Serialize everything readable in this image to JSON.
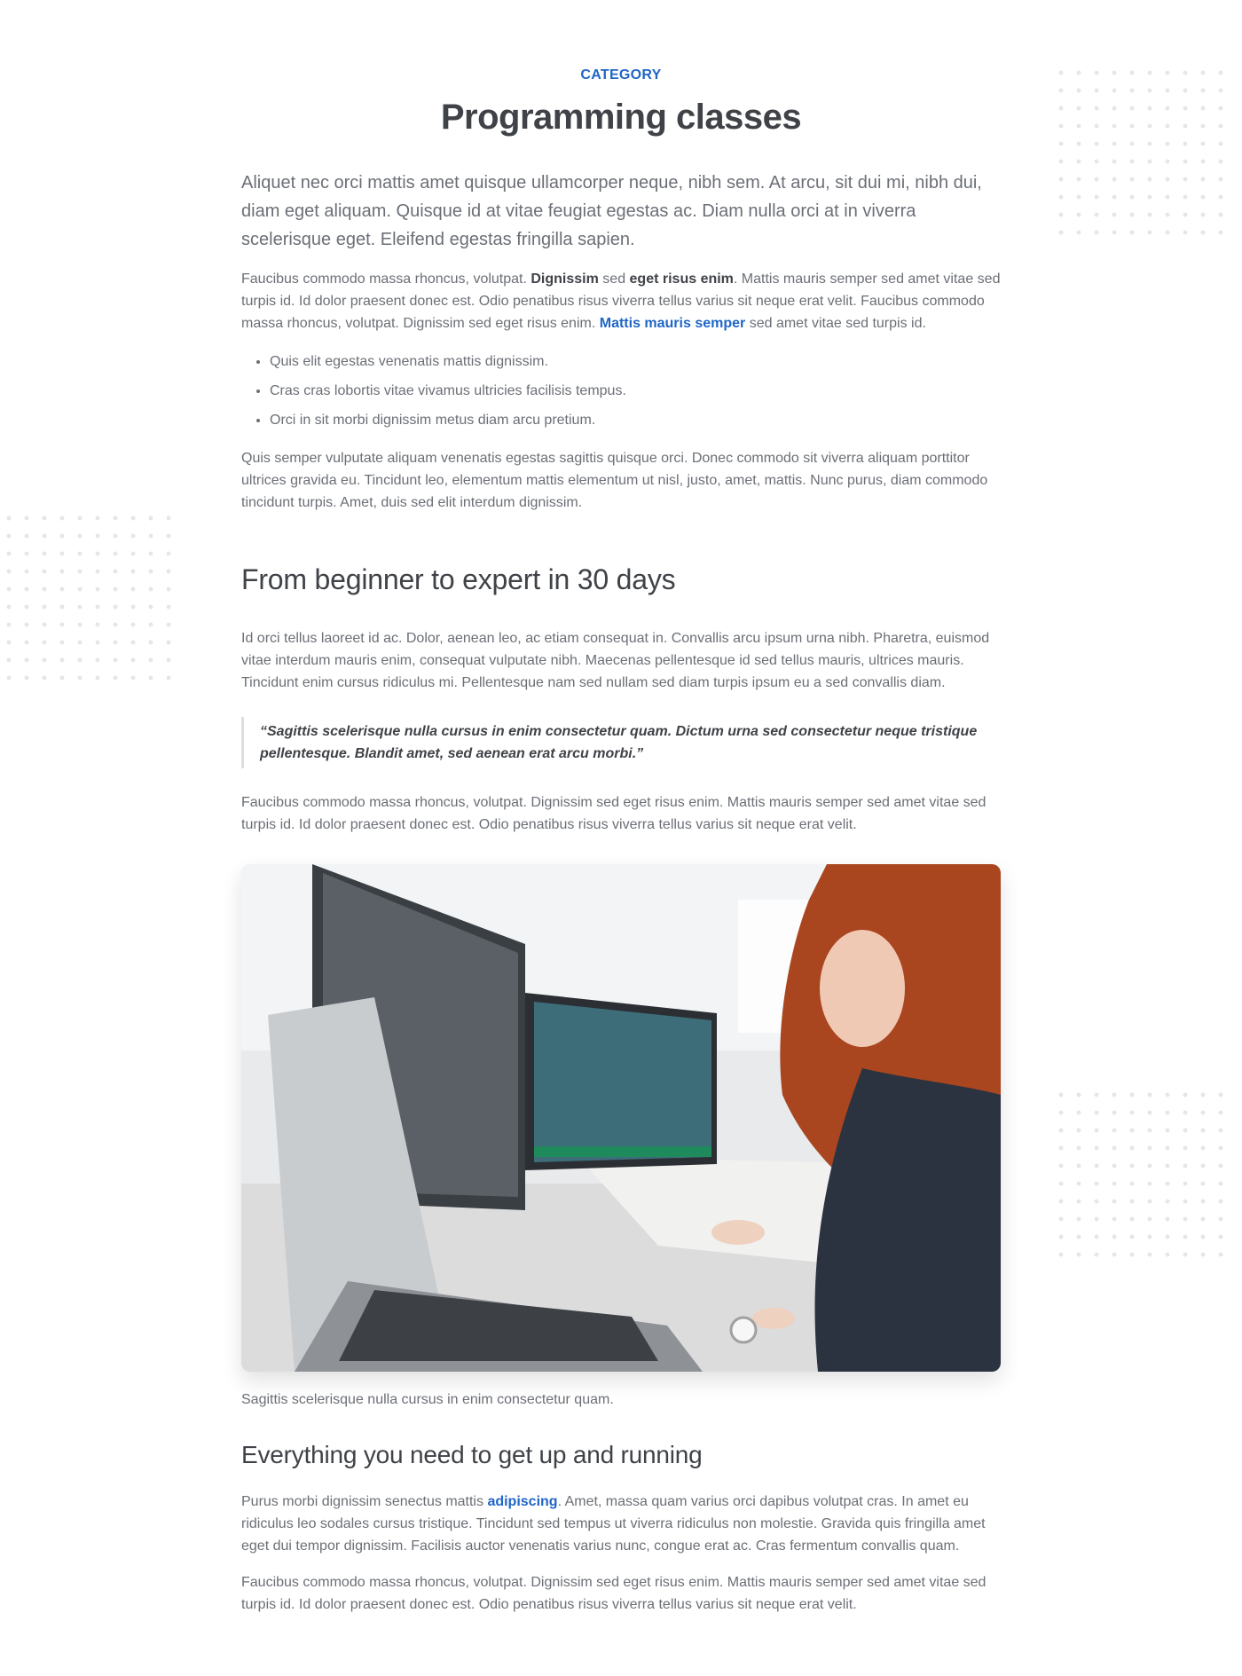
{
  "category": "CATEGORY",
  "title": "Programming classes",
  "lede": "Aliquet nec orci mattis amet quisque ullamcorper neque, nibh sem. At arcu, sit dui mi, nibh dui, diam eget aliquam. Quisque id at vitae feugiat egestas ac. Diam nulla orci at in viverra scelerisque eget. Eleifend egestas fringilla sapien.",
  "para1": {
    "t1": "Faucibus commodo massa rhoncus, volutpat. ",
    "b1": "Dignissim",
    "t2": " sed ",
    "b2": "eget risus enim",
    "t3": ". Mattis mauris semper sed amet vitae sed turpis id. Id dolor praesent donec est. Odio penatibus risus viverra tellus varius sit neque erat velit. Faucibus commodo massa rhoncus, volutpat. Dignissim sed eget risus enim. ",
    "link": "Mattis mauris semper",
    "t4": " sed amet vitae sed turpis id."
  },
  "bullets": [
    "Quis elit egestas venenatis mattis dignissim.",
    "Cras cras lobortis vitae vivamus ultricies facilisis tempus.",
    "Orci in sit morbi dignissim metus diam arcu pretium."
  ],
  "para2": "Quis semper vulputate aliquam venenatis egestas sagittis quisque orci. Donec commodo sit viverra aliquam porttitor ultrices gravida eu. Tincidunt leo, elementum mattis elementum ut nisl, justo, amet, mattis. Nunc purus, diam commodo tincidunt turpis. Amet, duis sed elit interdum dignissim.",
  "heading2": "From beginner to expert in 30 days",
  "para3": "Id orci tellus laoreet id ac. Dolor, aenean leo, ac etiam consequat in. Convallis arcu ipsum urna nibh. Pharetra, euismod vitae interdum mauris enim, consequat vulputate nibh. Maecenas pellentesque id sed tellus mauris, ultrices mauris. Tincidunt enim cursus ridiculus mi. Pellentesque nam sed nullam sed diam turpis ipsum eu a sed convallis diam.",
  "quote": "“Sagittis scelerisque nulla cursus in enim consectetur quam. Dictum urna sed consectetur neque tristique pellentesque. Blandit amet, sed aenean erat arcu morbi.”",
  "para4": "Faucibus commodo massa rhoncus, volutpat. Dignissim sed eget risus enim. Mattis mauris semper sed amet vitae sed turpis id. Id dolor praesent donec est. Odio penatibus risus viverra tellus varius sit neque erat velit.",
  "caption": "Sagittis scelerisque nulla cursus in enim consectetur quam.",
  "heading3": "Everything you need to get up and running",
  "para5": {
    "t1": "Purus morbi dignissim senectus mattis ",
    "link": "adipiscing",
    "t2": ". Amet, massa quam varius orci dapibus volutpat cras. In amet eu ridiculus leo sodales cursus tristique. Tincidunt sed tempus ut viverra ridiculus non molestie. Gravida quis fringilla amet eget dui tempor dignissim. Facilisis auctor venenatis varius nunc, congue erat ac. Cras fermentum convallis quam."
  },
  "para6": "Faucibus commodo massa rhoncus, volutpat. Dignissim sed eget risus enim. Mattis mauris semper sed amet vitae sed turpis id. Id dolor praesent donec est. Odio penatibus risus viverra tellus varius sit neque erat velit.",
  "colors": {
    "accent": "#1f66c6",
    "heading": "#3f4247",
    "body": "#6b6f76",
    "quote_border": "#dcdee2"
  }
}
